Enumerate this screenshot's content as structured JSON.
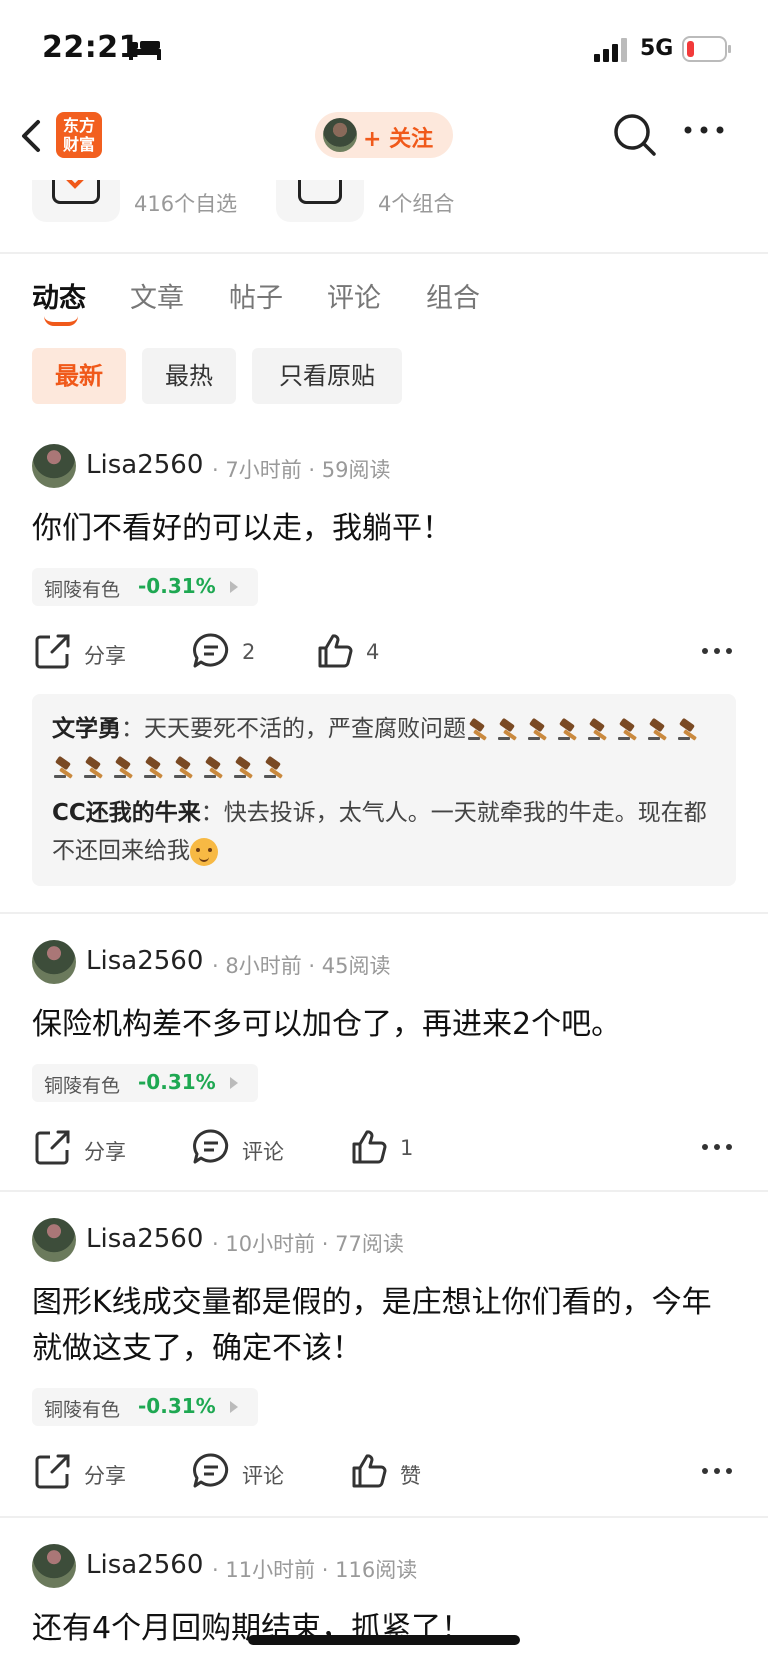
{
  "status_bar": {
    "time": "22:21",
    "network": "5G"
  },
  "nav": {
    "logo_text": "东方财富",
    "follow_label": "+ 关注"
  },
  "stats": {
    "watchlist": "416个自选",
    "portfolios": "4个组合"
  },
  "tabs": [
    "动态",
    "文章",
    "帖子",
    "评论",
    "组合"
  ],
  "filters": [
    "最新",
    "最热",
    "只看原贴"
  ],
  "colors": {
    "accent": "#f0591a",
    "down": "#1ea852"
  },
  "posts": [
    {
      "author": "Lisa2560",
      "time": "7小时前",
      "reads": "59阅读",
      "text": "你们不看好的可以走，我躺平！",
      "stock": "铜陵有色",
      "change": "-0.31%",
      "share": "分享",
      "comments": "2",
      "likes": "4",
      "replies": [
        {
          "name": "文学勇",
          "text": "天天要死不活的，严查腐败问题"
        },
        {
          "name": "CC还我的牛来",
          "text": "快去投诉，太气人。一天就牵我的牛走。现在都不还回来给我"
        }
      ]
    },
    {
      "author": "Lisa2560",
      "time": "8小时前",
      "reads": "45阅读",
      "text": "保险机构差不多可以加仓了，再进来2个吧。",
      "stock": "铜陵有色",
      "change": "-0.31%",
      "share": "分享",
      "comments": "评论",
      "likes": "1"
    },
    {
      "author": "Lisa2560",
      "time": "10小时前",
      "reads": "77阅读",
      "text": "图形K线成交量都是假的，是庄想让你们看的，今年就做这支了，确定不该！",
      "stock": "铜陵有色",
      "change": "-0.31%",
      "share": "分享",
      "comments": "评论",
      "likes": "赞"
    },
    {
      "author": "Lisa2560",
      "time": "11小时前",
      "reads": "116阅读",
      "text": "还有4个月回购期结束，抓紧了！"
    }
  ]
}
